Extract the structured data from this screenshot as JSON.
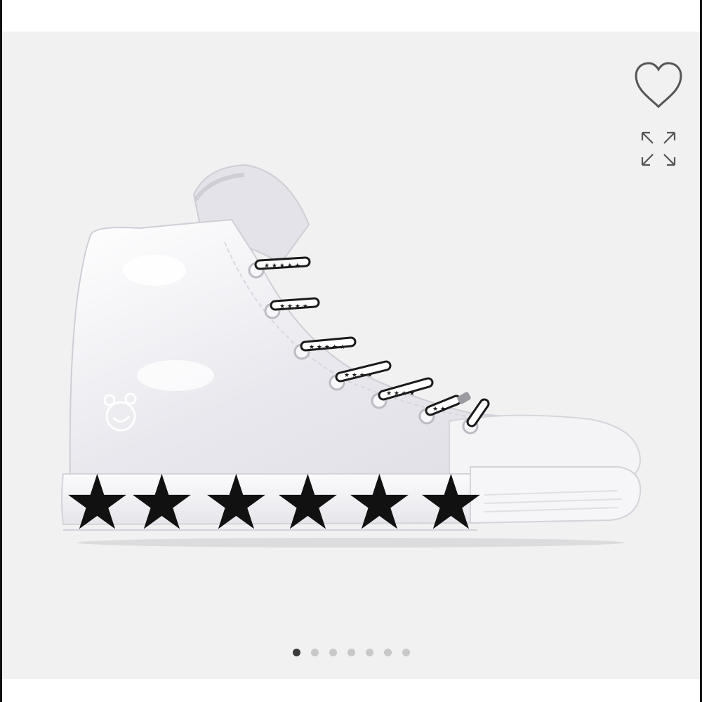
{
  "product": {
    "image_alt": "White high-top sneaker with black star sidewall"
  },
  "icons": {
    "favorite": "heart-outline-icon",
    "expand": "expand-arrows-icon"
  },
  "carousel": {
    "count": 7,
    "active_index": 0
  },
  "colors": {
    "viewer_bg": "#f1f1f2",
    "dot_active": "#3a3a3a",
    "dot_inactive": "#c8c8c8",
    "icon_stroke": "#555555"
  }
}
